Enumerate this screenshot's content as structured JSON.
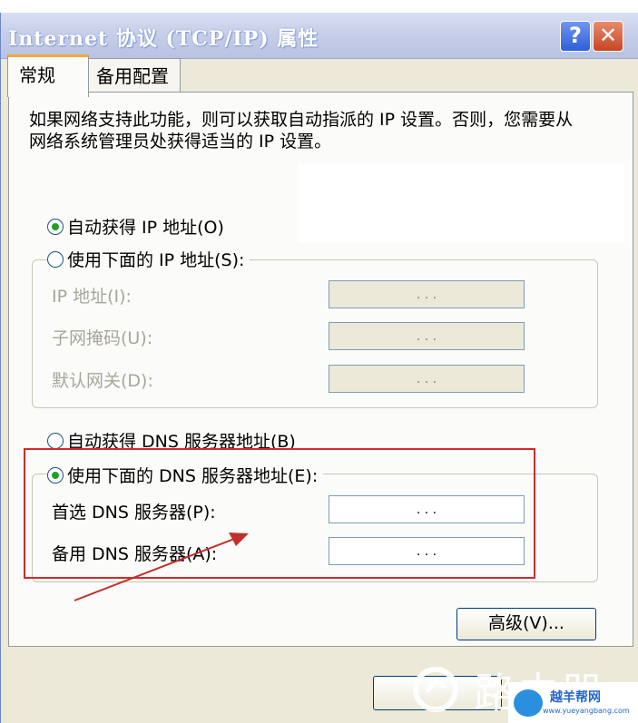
{
  "window": {
    "title": "Internet 协议 (TCP/IP) 属性",
    "help_label": "?",
    "close_label": "✕"
  },
  "tabs": [
    {
      "label": "常规",
      "active": true
    },
    {
      "label": "备用配置",
      "active": false
    }
  ],
  "description": "如果网络支持此功能，则可以获取自动指派的 IP 设置。否则，您需要从网络系统管理员处获得适当的 IP 设置。",
  "ip_section": {
    "auto_option": "自动获得 IP 地址(O)",
    "manual_option": "使用下面的 IP 地址(S):",
    "auto_selected": true,
    "fields": [
      {
        "label": "IP 地址(I):",
        "value": ".   .   ."
      },
      {
        "label": "子网掩码(U):",
        "value": ".   .   ."
      },
      {
        "label": "默认网关(D):",
        "value": ".   .   ."
      }
    ]
  },
  "dns_section": {
    "auto_option": "自动获得 DNS 服务器地址(B)",
    "manual_option": "使用下面的 DNS 服务器地址(E):",
    "manual_selected": true,
    "fields": [
      {
        "label": "首选 DNS 服务器(P):",
        "value": ".   .   ."
      },
      {
        "label": "备用 DNS 服务器(A):",
        "value": ".   .   ."
      }
    ]
  },
  "advanced_button": "高级(V)...",
  "watermark": {
    "text": "路由器",
    "site_name": "越羊帮网",
    "site_url": "www.yueyangbang.com"
  },
  "colors": {
    "highlight_box": "#d42a2a",
    "arrow": "#c0302c",
    "tab_accent": "#f2a93b"
  }
}
